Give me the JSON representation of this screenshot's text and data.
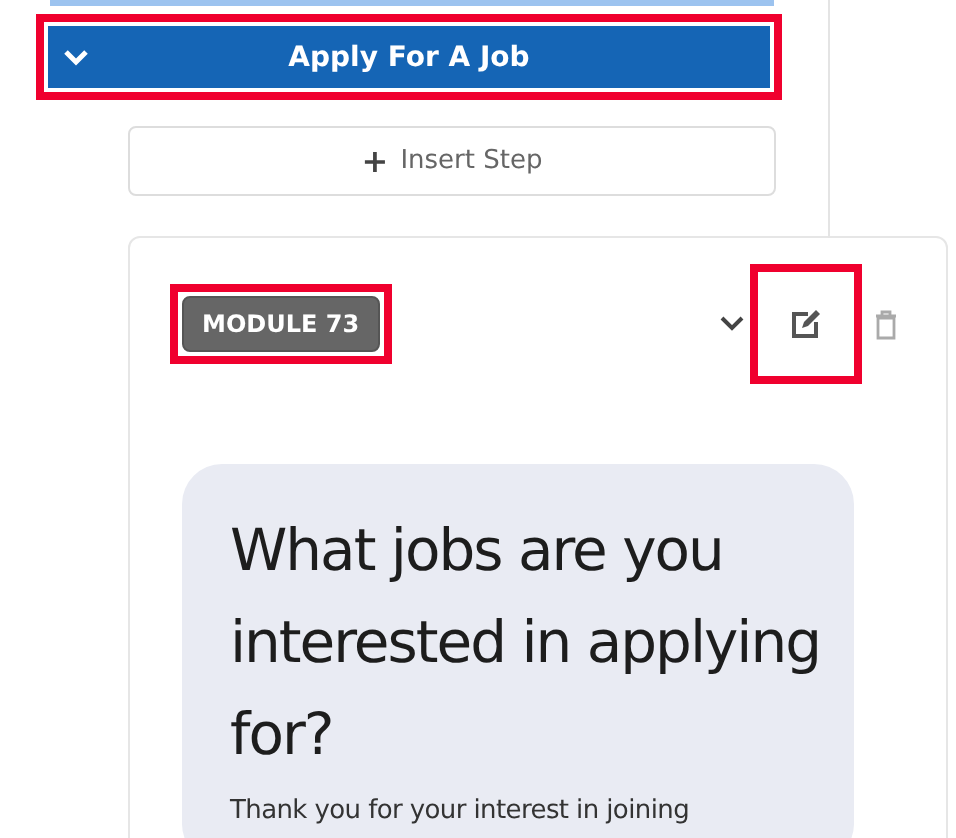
{
  "step_header": {
    "title": "Apply For A Job",
    "expanded": true,
    "highlighted": true
  },
  "insert_button": {
    "label": "Insert Step",
    "icon": "+"
  },
  "module": {
    "badge": "MODULE 73",
    "badge_highlighted": true,
    "edit_highlighted": true,
    "question": "What jobs are you interested in applying for?",
    "body": "Thank you for your interest in joining"
  }
}
